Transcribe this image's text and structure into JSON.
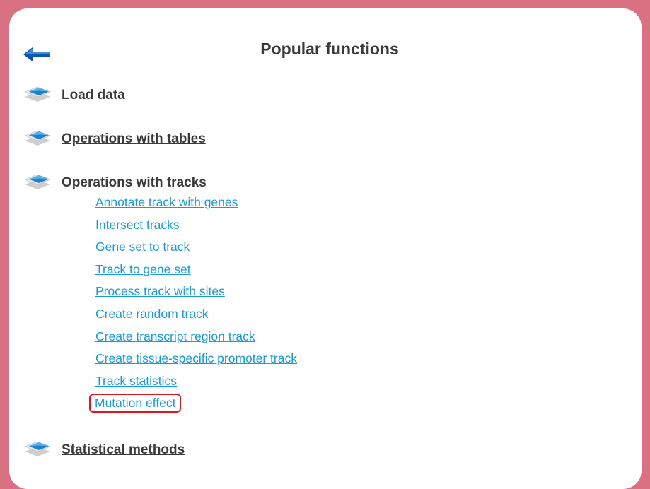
{
  "title": "Popular functions",
  "back_icon": "back-arrow-icon",
  "accent_color": "#d97183",
  "link_color": "#1a9ad6",
  "highlight_color": "#e0161e",
  "sections": [
    {
      "label": "Load data",
      "icon": "layers-icon"
    },
    {
      "label": "Operations with tables",
      "icon": "layers-icon"
    },
    {
      "label": "Operations with tracks",
      "icon": "layers-icon"
    },
    {
      "label": "Statistical methods",
      "icon": "layers-icon"
    }
  ],
  "track_operations": [
    "Annotate track with genes",
    "Intersect tracks",
    "Gene set to track",
    "Track to gene set",
    "Process track with sites",
    "Create random track",
    "Create transcript region track",
    "Create tissue-specific promoter track",
    "Track statistics",
    "Mutation effect"
  ],
  "highlighted_item": "Mutation effect"
}
